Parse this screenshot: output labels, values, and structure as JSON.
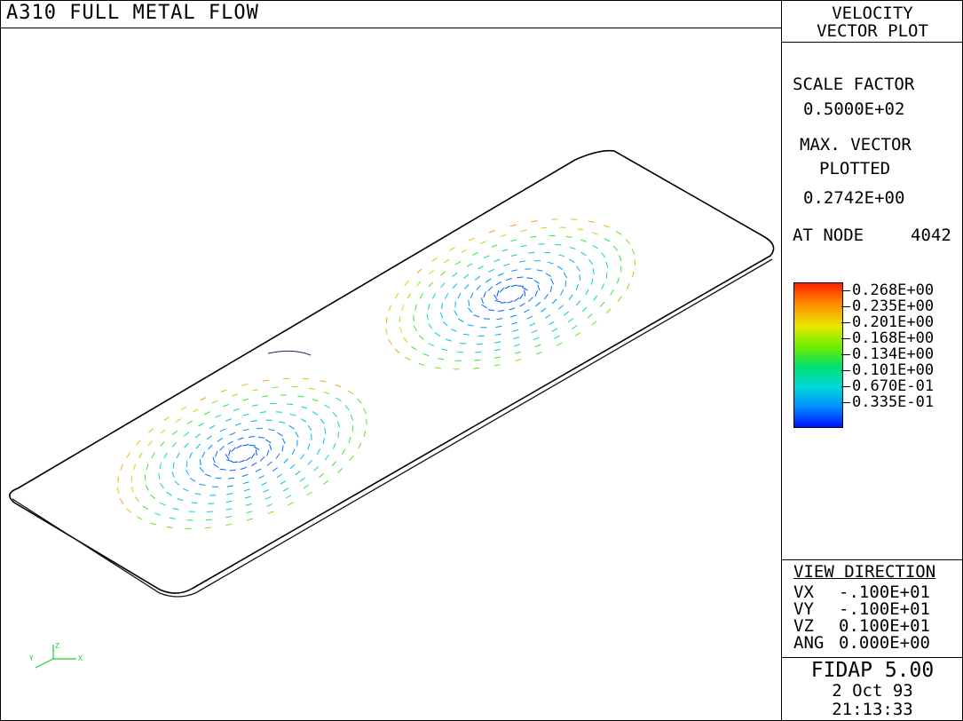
{
  "title": "A310 FULL METAL FLOW",
  "plot_type": {
    "line1": "VELOCITY",
    "line2": "VECTOR PLOT"
  },
  "scale_factor": {
    "label": "SCALE FACTOR",
    "value": "0.5000E+02"
  },
  "max_vector": {
    "label1": "MAX. VECTOR",
    "label2": "PLOTTED",
    "value": "0.2742E+00",
    "node_label": "AT NODE",
    "node": "4042"
  },
  "legend": [
    "0.268E+00",
    "0.235E+00",
    "0.201E+00",
    "0.168E+00",
    "0.134E+00",
    "0.101E+00",
    "0.670E-01",
    "0.335E-01"
  ],
  "view": {
    "title": "VIEW DIRECTION",
    "rows": [
      {
        "k": "VX",
        "v": "-.100E+01"
      },
      {
        "k": "VY",
        "v": "-.100E+01"
      },
      {
        "k": "VZ",
        "v": "0.100E+01"
      },
      {
        "k": "ANG",
        "v": "0.000E+00"
      }
    ]
  },
  "software": {
    "name": "FIDAP 5.00",
    "date": "2 Oct 93",
    "time": "21:13:33"
  },
  "axes": {
    "x": "X",
    "y": "Y",
    "z": "Z"
  },
  "colors": {
    "outline": "#000000",
    "triad": "#22cc22"
  }
}
